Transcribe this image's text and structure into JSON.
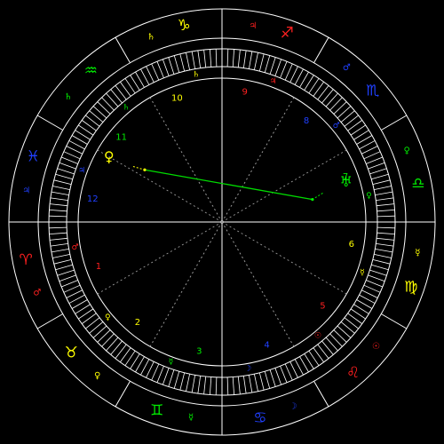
{
  "colors": {
    "background": "#000000",
    "line": "#ffffff",
    "dotted": "#9a9a9a",
    "aspect": "#00dd00",
    "fire": "#ff2020",
    "earth": "#ffff00",
    "air": "#00ee00",
    "water": "#2040ff",
    "planet": "#ffff66"
  },
  "zodiac": [
    {
      "glyph": "♈",
      "name": "aries",
      "ruler": "♂",
      "element": "fire"
    },
    {
      "glyph": "♉",
      "name": "taurus",
      "ruler": "♀",
      "element": "earth"
    },
    {
      "glyph": "♊",
      "name": "gemini",
      "ruler": "☿",
      "element": "air"
    },
    {
      "glyph": "♋",
      "name": "cancer",
      "ruler": "☽",
      "element": "water"
    },
    {
      "glyph": "♌",
      "name": "leo",
      "ruler": "☉",
      "element": "fire"
    },
    {
      "glyph": "♍",
      "name": "virgo",
      "ruler": "☿",
      "element": "earth"
    },
    {
      "glyph": "♎",
      "name": "libra",
      "ruler": "♀",
      "element": "air"
    },
    {
      "glyph": "♏",
      "name": "scorpio",
      "ruler": "♂",
      "element": "water"
    },
    {
      "glyph": "♐",
      "name": "sagittarius",
      "ruler": "♃",
      "element": "fire"
    },
    {
      "glyph": "♑",
      "name": "capricorn",
      "ruler": "♄",
      "element": "earth"
    },
    {
      "glyph": "♒",
      "name": "aquarius",
      "ruler": "♄",
      "element": "air"
    },
    {
      "glyph": "♓",
      "name": "pisces",
      "ruler": "♃",
      "element": "water"
    }
  ],
  "houses": [
    {
      "num": "1",
      "ruler": "♂",
      "element": "fire"
    },
    {
      "num": "2",
      "ruler": "♀",
      "element": "earth"
    },
    {
      "num": "3",
      "ruler": "☿",
      "element": "air"
    },
    {
      "num": "4",
      "ruler": "☽",
      "element": "water"
    },
    {
      "num": "5",
      "ruler": "☉",
      "element": "fire"
    },
    {
      "num": "6",
      "ruler": "☿",
      "element": "earth"
    },
    {
      "num": "7",
      "ruler": "♀",
      "element": "air"
    },
    {
      "num": "8",
      "ruler": "♂",
      "element": "water"
    },
    {
      "num": "9",
      "ruler": "♃",
      "element": "fire"
    },
    {
      "num": "10",
      "ruler": "♄",
      "element": "earth"
    },
    {
      "num": "11",
      "ruler": "♄",
      "element": "air"
    },
    {
      "num": "12",
      "ruler": "♃",
      "element": "water"
    }
  ],
  "planets": [
    {
      "glyph": "♀",
      "name": "venus",
      "element": "earth"
    },
    {
      "glyph": "♅",
      "name": "uranus",
      "element": "air"
    }
  ],
  "aspects": [
    {
      "from": "venus",
      "to": "uranus",
      "type": "line"
    }
  ]
}
